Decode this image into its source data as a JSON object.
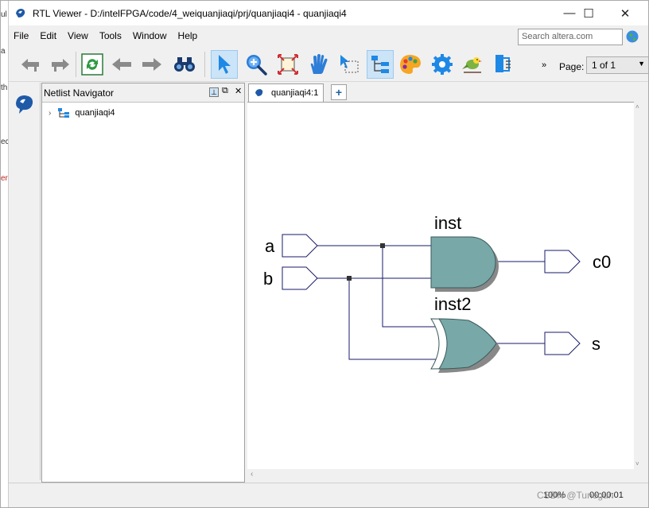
{
  "titlebar": {
    "title": "RTL Viewer - D:/intelFPGA/code/4_weiquanjiaqi/prj/quanjiaqi4 - quanjiaqi4",
    "minimize": "—",
    "maximize": "☐",
    "close": "✕"
  },
  "menu": {
    "file": "File",
    "edit": "Edit",
    "view": "View",
    "tools": "Tools",
    "window": "Window",
    "help": "Help"
  },
  "search": {
    "placeholder": "Search altera.com"
  },
  "toolbar": {
    "overflow": "»",
    "page_label": "Page:",
    "page_value": "1 of 1"
  },
  "navigator": {
    "title": "Netlist Navigator",
    "tree_root": "quanjiaqi4"
  },
  "tabs": {
    "active": "quanjiaqi4:1",
    "add": "+"
  },
  "schematic": {
    "inputs": [
      "a",
      "b"
    ],
    "outputs": [
      "c0",
      "s"
    ],
    "gates": [
      {
        "name": "inst",
        "type": "AND"
      },
      {
        "name": "inst2",
        "type": "OR"
      }
    ],
    "gate_fill": "#78a8a8",
    "wire_color": "#1a1a6e"
  },
  "status": {
    "zoom": "100%",
    "time": "00:00:01",
    "watermark": "CSDN @Tunegun"
  },
  "edge_fragments": [
    "ul",
    "a",
    "th",
    "ec",
    "er"
  ]
}
